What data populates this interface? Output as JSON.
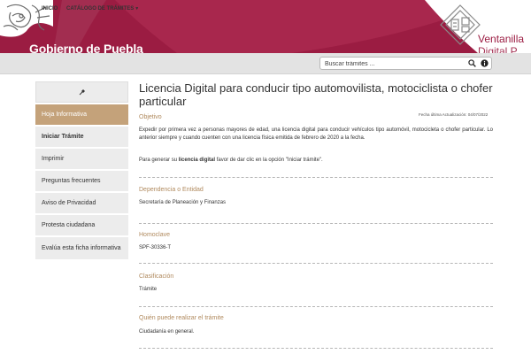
{
  "header": {
    "brand_left": "Gobierno de Puebla",
    "brand_right": "Ventanilla",
    "brand_right_sub": "Digital P",
    "brand_color": "#9b1c42",
    "icons": [
      "puebla-logo-icon",
      "ventanilla-logo-icon"
    ]
  },
  "nav": {
    "inicio": "INICIO",
    "catalogo": "CATÁLOGO DE TRÁMITES",
    "search_placeholder": "Buscar trámites ...",
    "icons": [
      "search-icon",
      "info-icon"
    ]
  },
  "sidebar": {
    "pin_icon": "pin-icon",
    "items": [
      {
        "label": "Hoja Informativa",
        "active": true
      },
      {
        "label": "Iniciar Trámite",
        "bold": true
      },
      {
        "label": "Imprimir"
      },
      {
        "label": "Preguntas frecuentes"
      },
      {
        "label": "Aviso de Privacidad"
      },
      {
        "label": "Protesta ciudadana"
      },
      {
        "label": "Evalúa esta ficha informativa"
      }
    ],
    "active_color": "#c4a27a"
  },
  "main": {
    "title": "Licencia Digital para conducir tipo automovilista, motociclista o chofer particular",
    "update_date": "Fecha última Actualización: 04/07/2022",
    "objetivo_label": "Objetivo",
    "objetivo_text": "Expedir por primera vez a personas mayores de edad, una licencia digital para conducir vehículos tipo automóvil, motocicleta o chofer particular. Lo anterior siempre y cuando cuenten con una licencia física emitida de febrero de 2020 a la fecha.",
    "generar_prefix": "Para generar su ",
    "generar_bold": "licencia digital",
    "generar_suffix": " favor de dar clic en la opción \"Iniciar trámite\".",
    "dependencia_label": "Dependencia o Entidad",
    "dependencia_value": "Secretaría de Planeación y Finanzas",
    "homoclave_label": "Homoclave",
    "homoclave_value": "SPF-30336-T",
    "clasificacion_label": "Clasificación",
    "clasificacion_value": "Trámite",
    "quien_label": "Quién puede realizar el trámite",
    "quien_value": "Ciudadanía en general.",
    "accent_color": "#b08a5e"
  }
}
